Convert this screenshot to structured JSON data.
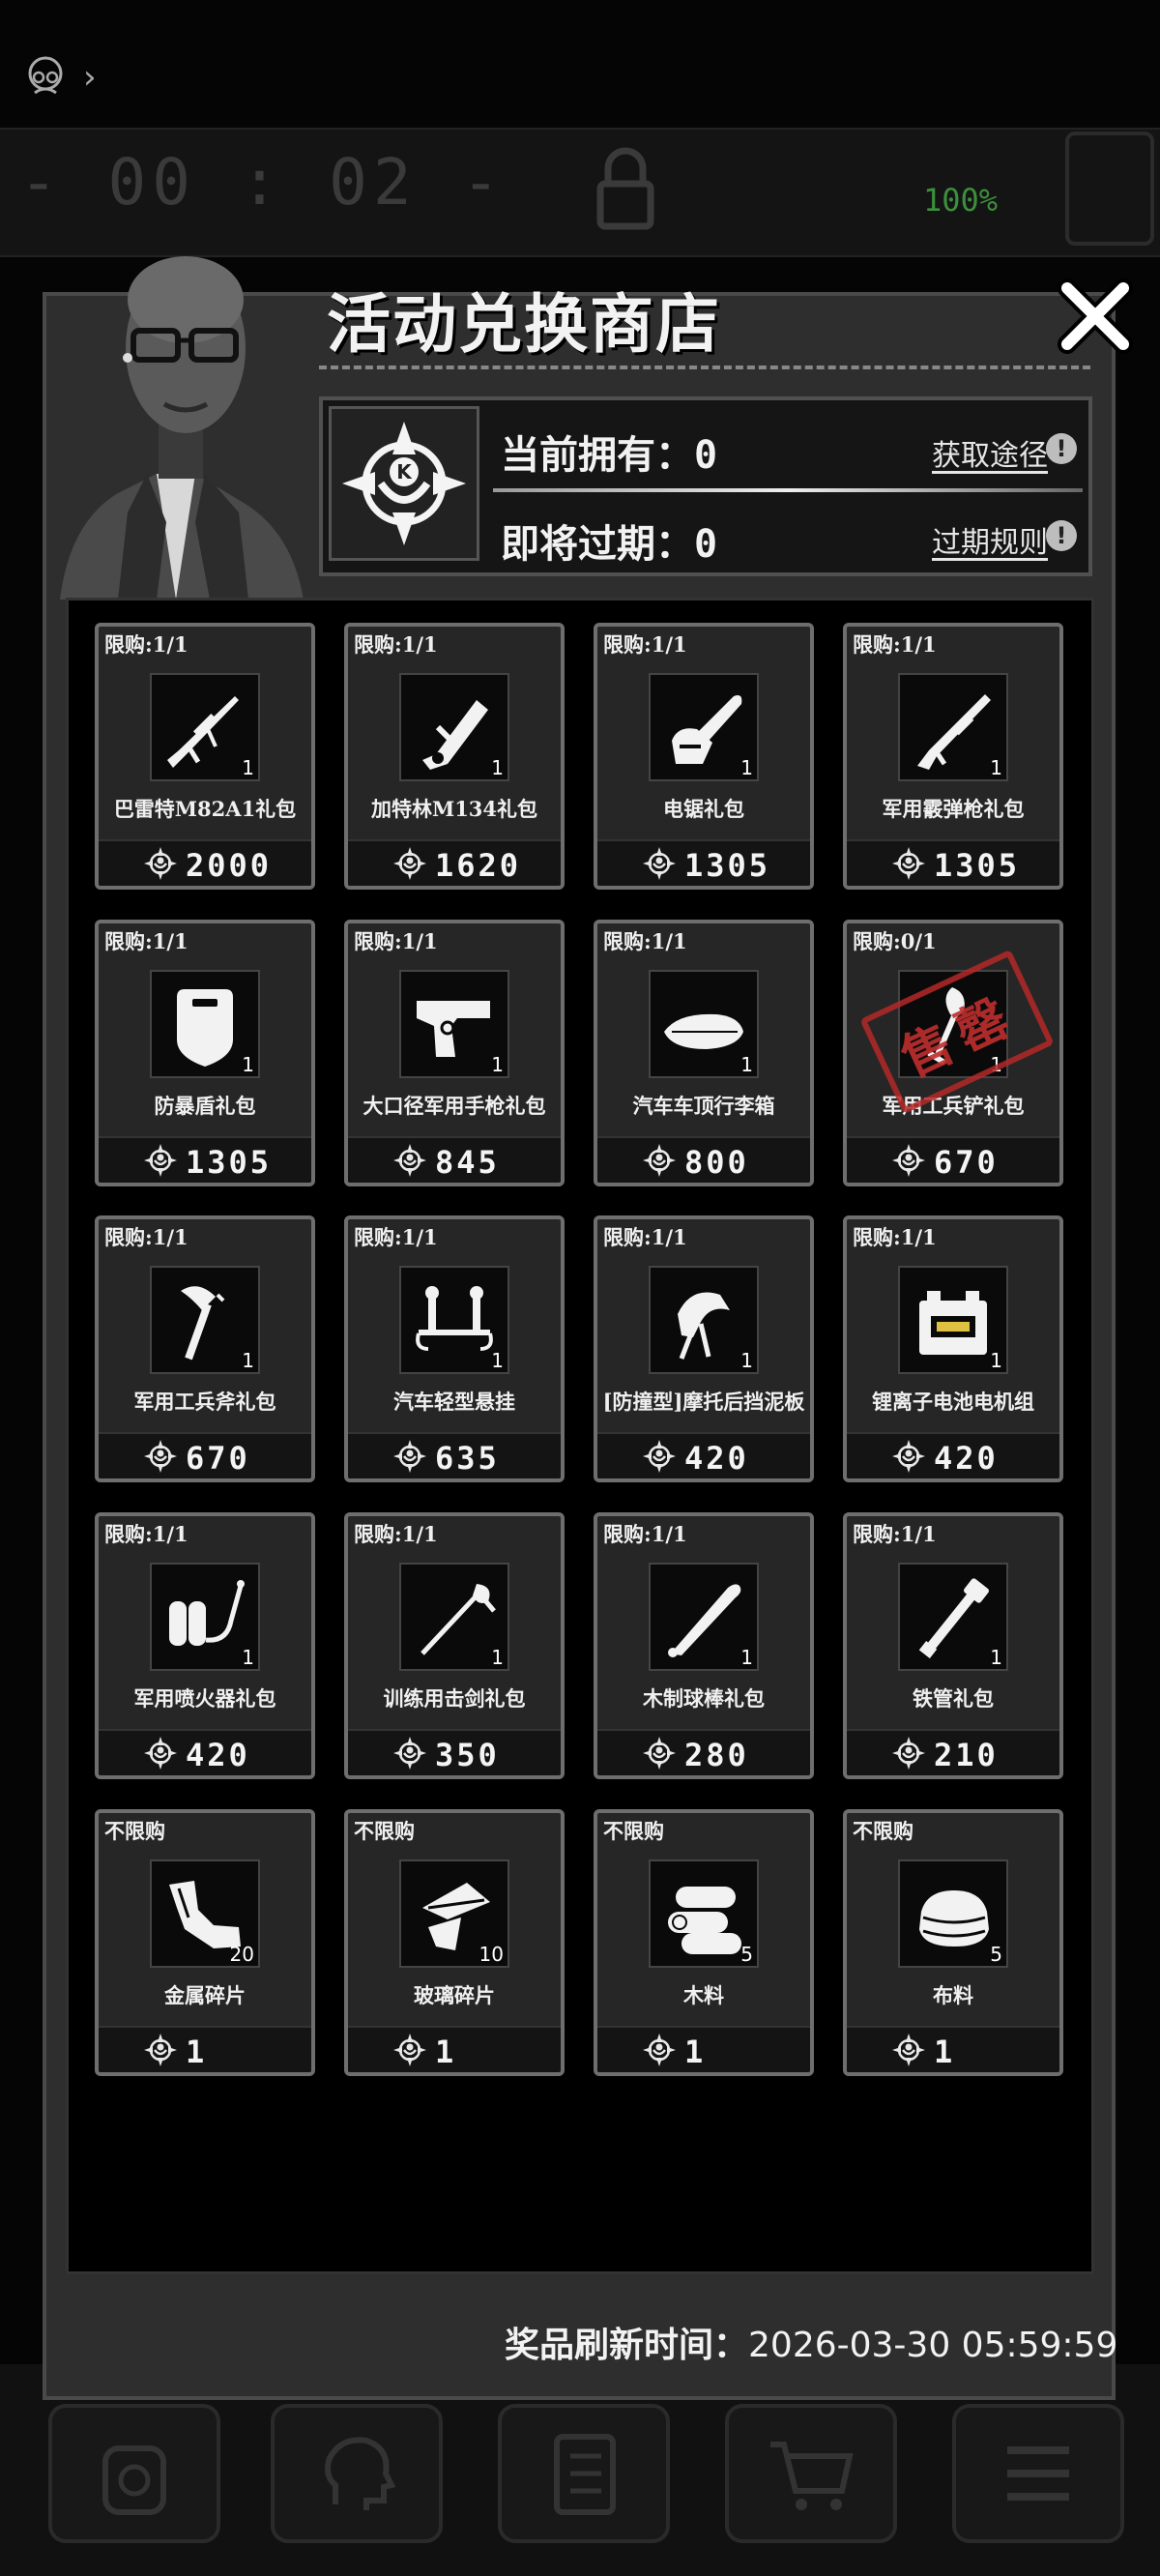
{
  "shop": {
    "title": "活动兑换商店",
    "owned_label": "当前拥有：",
    "owned_value": "0",
    "expiring_label": "即将过期：",
    "expiring_value": "0",
    "obtain_link": "获取途径",
    "expiry_link": "过期规则",
    "info_glyph": "!",
    "refresh_label": "奖品刷新时间：",
    "refresh_time": "2026-03-30 05:59:59"
  },
  "hud": {
    "timer": "- 00 : 02 -",
    "percent": "100%"
  },
  "items": [
    {
      "limit": "限购:1/1",
      "name": "巴雷特M82A1礼包",
      "price": "2000",
      "qty": "1",
      "icon": "sniper-rifle-icon",
      "sold_out": false
    },
    {
      "limit": "限购:1/1",
      "name": "加特林M134礼包",
      "price": "1620",
      "qty": "1",
      "icon": "gatling-gun-icon",
      "sold_out": false
    },
    {
      "limit": "限购:1/1",
      "name": "电锯礼包",
      "price": "1305",
      "qty": "1",
      "icon": "chainsaw-icon",
      "sold_out": false
    },
    {
      "limit": "限购:1/1",
      "name": "军用霰弹枪礼包",
      "price": "1305",
      "qty": "1",
      "icon": "shotgun-icon",
      "sold_out": false
    },
    {
      "limit": "限购:1/1",
      "name": "防暴盾礼包",
      "price": "1305",
      "qty": "1",
      "icon": "riot-shield-icon",
      "sold_out": false
    },
    {
      "limit": "限购:1/1",
      "name": "大口径军用手枪礼包",
      "price": "845",
      "qty": "1",
      "icon": "pistol-icon",
      "sold_out": false
    },
    {
      "limit": "限购:1/1",
      "name": "汽车车顶行李箱",
      "price": "800",
      "qty": "1",
      "icon": "roof-box-icon",
      "sold_out": false
    },
    {
      "limit": "限购:0/1",
      "name": "军用工兵铲礼包",
      "price": "670",
      "qty": "1",
      "icon": "shovel-icon",
      "sold_out": true,
      "stamp": "售罄"
    },
    {
      "limit": "限购:1/1",
      "name": "军用工兵斧礼包",
      "price": "670",
      "qty": "1",
      "icon": "axe-icon",
      "sold_out": false
    },
    {
      "limit": "限购:1/1",
      "name": "汽车轻型悬挂",
      "price": "635",
      "qty": "1",
      "icon": "suspension-icon",
      "sold_out": false
    },
    {
      "limit": "限购:1/1",
      "name": "[防撞型]摩托后挡泥板",
      "price": "420",
      "qty": "1",
      "icon": "mudguard-icon",
      "sold_out": false
    },
    {
      "limit": "限购:1/1",
      "name": "锂离子电池电机组",
      "price": "420",
      "qty": "1",
      "icon": "battery-icon",
      "sold_out": false
    },
    {
      "limit": "限购:1/1",
      "name": "军用喷火器礼包",
      "price": "420",
      "qty": "1",
      "icon": "flamethrower-icon",
      "sold_out": false
    },
    {
      "limit": "限购:1/1",
      "name": "训练用击剑礼包",
      "price": "350",
      "qty": "1",
      "icon": "fencing-sword-icon",
      "sold_out": false
    },
    {
      "limit": "限购:1/1",
      "name": "木制球棒礼包",
      "price": "280",
      "qty": "1",
      "icon": "baseball-bat-icon",
      "sold_out": false
    },
    {
      "limit": "限购:1/1",
      "name": "铁管礼包",
      "price": "210",
      "qty": "1",
      "icon": "iron-pipe-icon",
      "sold_out": false
    },
    {
      "limit": "不限购",
      "name": "金属碎片",
      "price": "1",
      "qty": "20",
      "icon": "metal-scrap-icon",
      "sold_out": false
    },
    {
      "limit": "不限购",
      "name": "玻璃碎片",
      "price": "1",
      "qty": "10",
      "icon": "glass-shard-icon",
      "sold_out": false
    },
    {
      "limit": "不限购",
      "name": "木料",
      "price": "1",
      "qty": "5",
      "icon": "wood-log-icon",
      "sold_out": false
    },
    {
      "limit": "不限购",
      "name": "布料",
      "price": "1",
      "qty": "5",
      "icon": "cloth-icon",
      "sold_out": false
    }
  ]
}
